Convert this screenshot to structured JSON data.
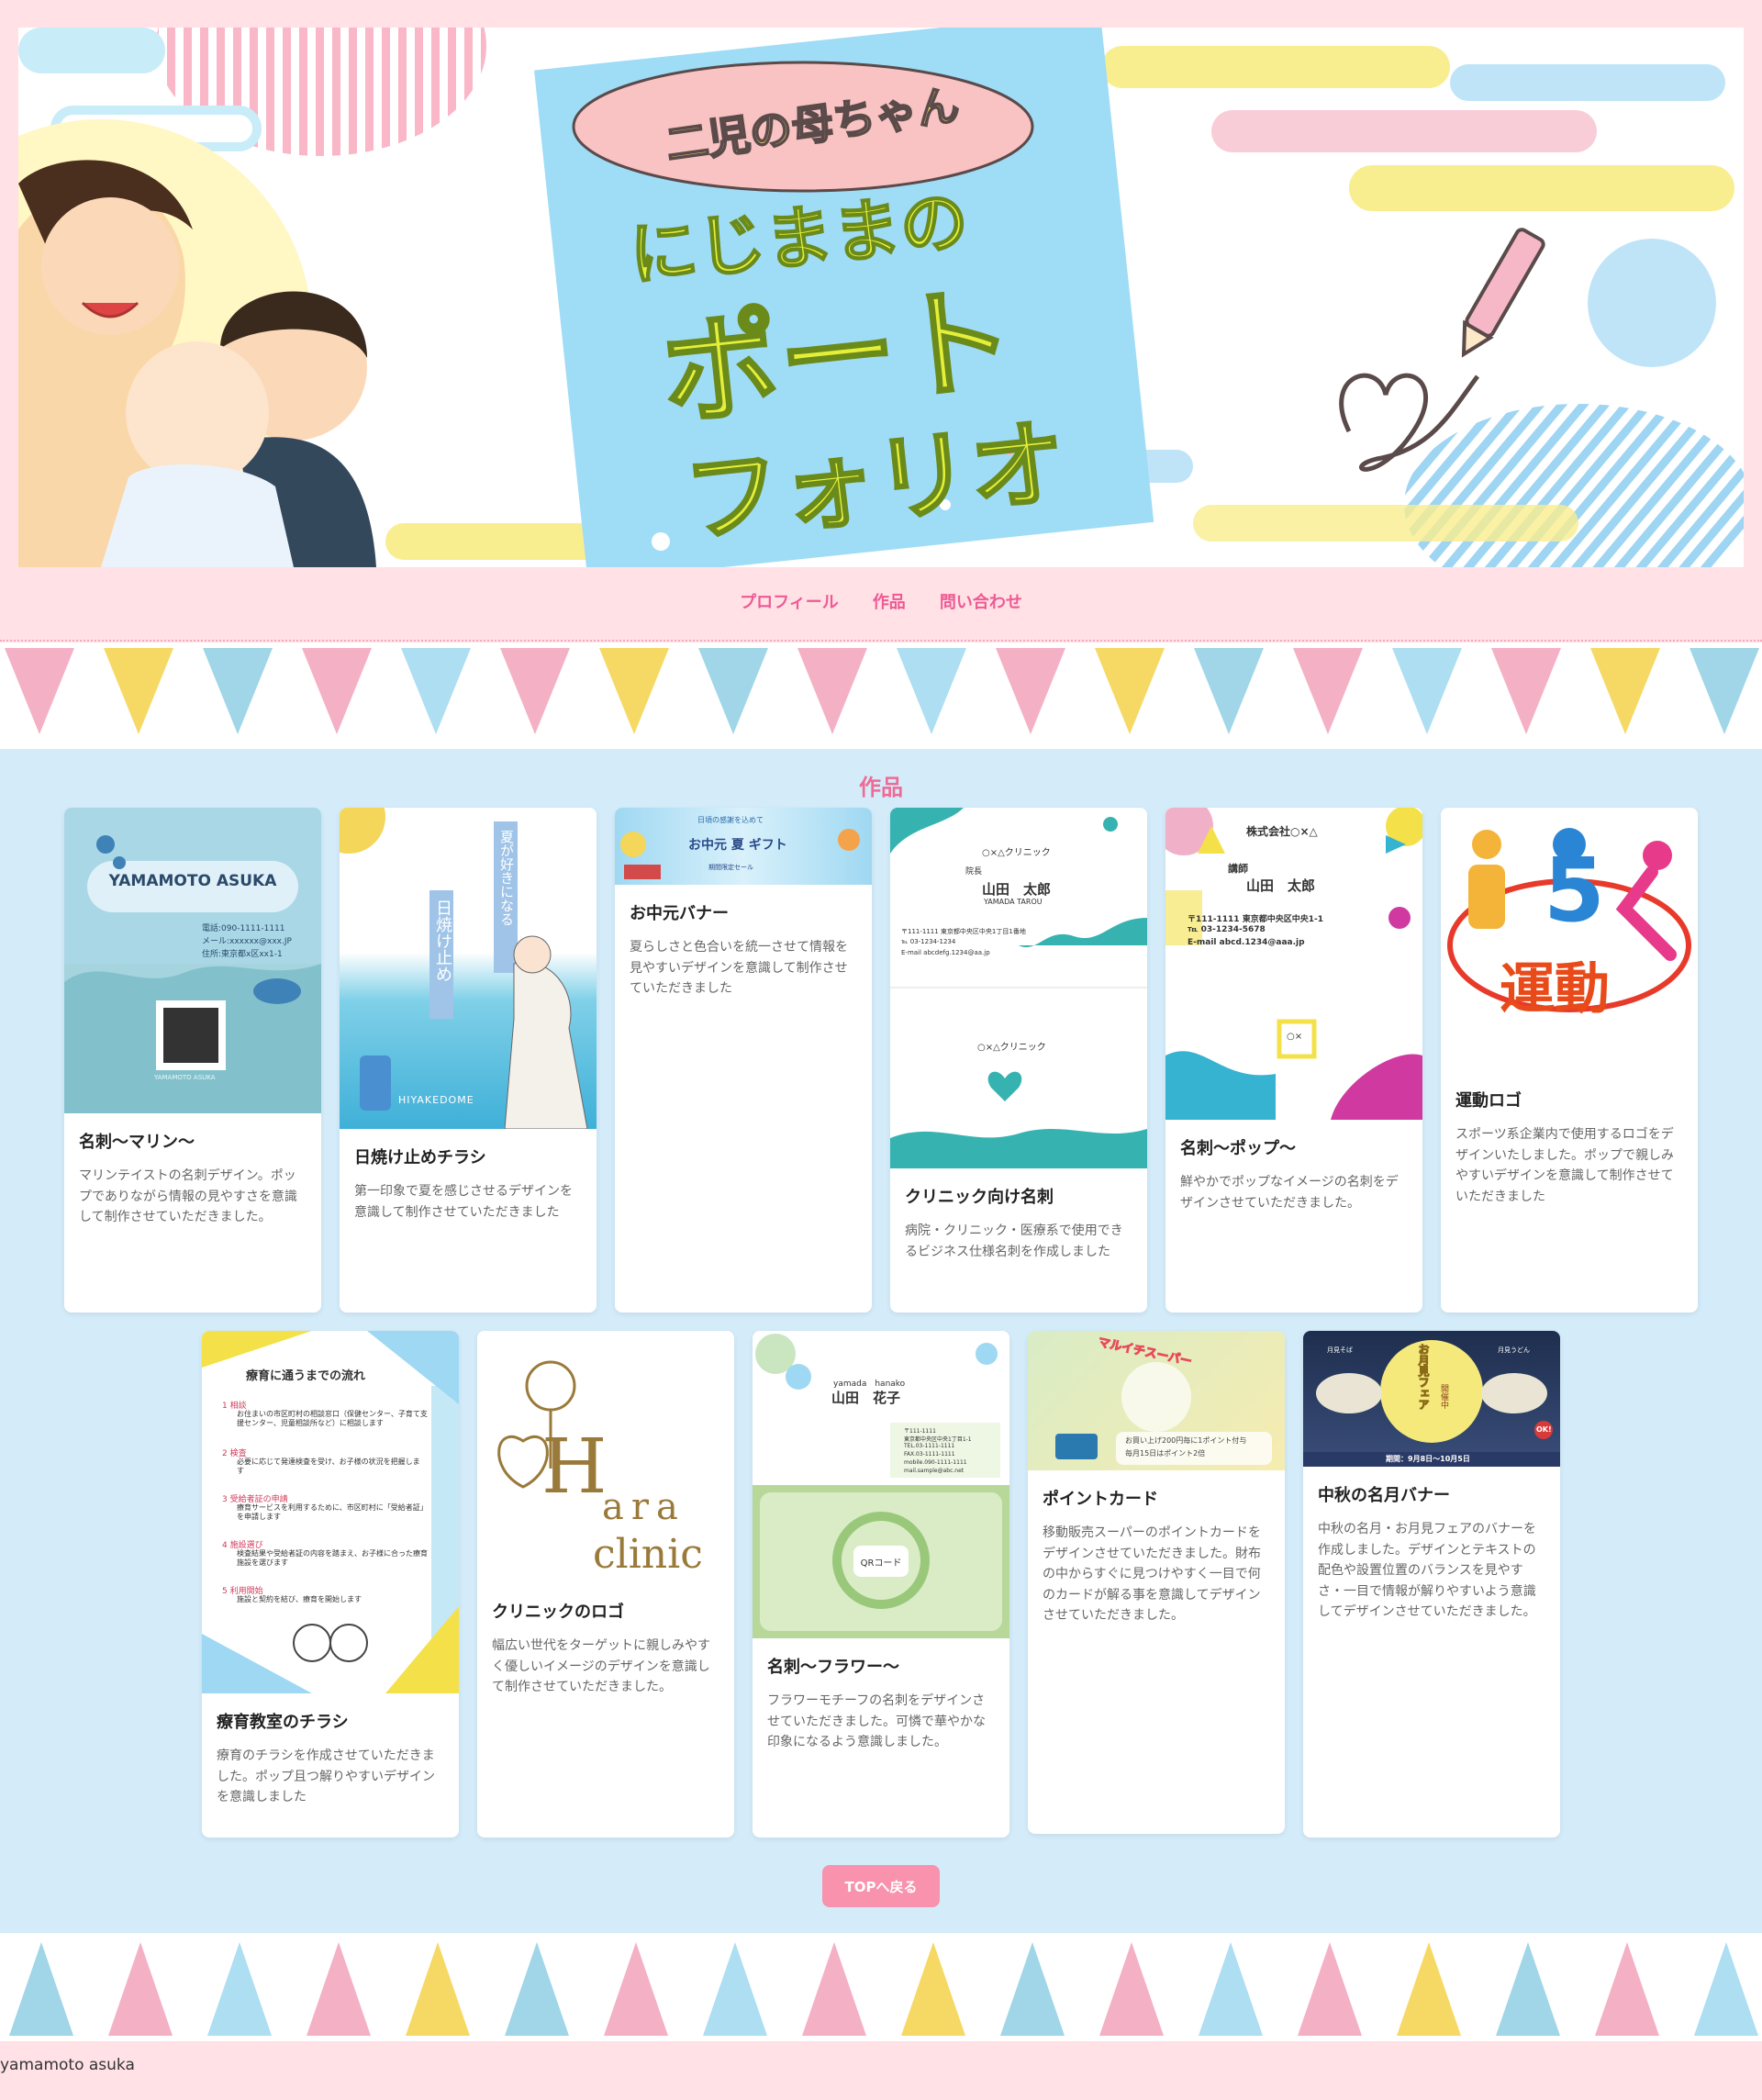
{
  "hero": {
    "subtitle": "二児の母ちゃん",
    "title_line1": "にじままの",
    "title_line2": "ポート",
    "title_line3": "フォリオ"
  },
  "nav": {
    "items": [
      "プロフィール",
      "作品",
      "問い合わせ"
    ]
  },
  "works": {
    "title": "作品",
    "cards": [
      {
        "title": "名刺〜マリン〜",
        "desc": "マリンテイストの名刺デザイン。ポップでありながら情報の見やすさを意識して制作させていただきました。",
        "thumb_text": [
          "YAMAMOTO ASUKA",
          "電話:090-1111-1111",
          "メール:xxxxxx@xxx.JP",
          "住所:東京都x区xx1-1",
          "YAMAMOTO ASUKA"
        ]
      },
      {
        "title": "日焼け止めチラシ",
        "desc": "第一印象で夏を感じさせるデザインを意識して制作させていただきました",
        "thumb_text": [
          "夏が好きになる",
          "日焼け止め",
          "HIYAKEDOME"
        ]
      },
      {
        "title": "お中元バナー",
        "desc": "夏らしさと色合いを統一させて情報を見やすいデザインを意識して制作させていただきました",
        "thumb_text": [
          "日頃の感謝を込めて",
          "お中元 夏 ギフト",
          "期間限定セール"
        ]
      },
      {
        "title": "クリニック向け名刺",
        "desc": "病院・クリニック・医療系で使用できるビジネス仕様名刺を作成しました",
        "thumb_text": [
          "○×△クリニック",
          "院長",
          "山田　太郎",
          "YAMADA TAROU",
          "〒111-1111 東京都中央区中央1丁目1番地",
          "℡ 03-1234-1234",
          "E-mail abcdefg.1234@aa.jp",
          "○×△クリニック"
        ]
      },
      {
        "title": "名刺〜ポップ〜",
        "desc": "鮮やかでポップなイメージの名刺をデザインさせていただきました。",
        "thumb_text": [
          "株式会社○×△",
          "講師",
          "山田　太郎",
          "〒111-1111 東京都中央区中央1-1",
          "℡ 03-1234-5678",
          "E-mail abcd.1234@aaa.jp",
          "○×"
        ]
      },
      {
        "title": "運動ロゴ",
        "desc": "スポーツ系企業内で使用するロゴをデザインいたしました。ポップで親しみやすいデザインを意識して制作させていただきました",
        "thumb_text": [
          "5",
          "運動"
        ]
      },
      {
        "title": "療育教室のチラシ",
        "desc": "療育のチラシを作成させていただきました。ポップ且つ解りやすいデザインを意識しました",
        "thumb_text": [
          "療育に通うまでの流れ",
          "1 相談",
          "お住まいの市区町村の相談窓口（保健センター、子育て支援センター、児童相談所など）に相談します",
          "2 検査",
          "必要に応じて発達検査を受け、お子様の状況を把握します",
          "3 受給者証の申請",
          "療育サービスを利用するために、市区町村に「受給者証」を申請します",
          "4 施設選び",
          "検査結果や受給者証の内容を踏まえ、お子様に合った療育施設を選びます",
          "5 利用開始",
          "施設と契約を結び、療育を開始します"
        ]
      },
      {
        "title": "クリニックのロゴ",
        "desc": "幅広い世代をターゲットに親しみやすく優しいイメージのデザインを意識して制作させていただきました。",
        "thumb_text": [
          "H",
          "ara",
          "clinic"
        ]
      },
      {
        "title": "名刺〜フラワー〜",
        "desc": "フラワーモチーフの名刺をデザインさせていただきました。可憐で華やかな印象になるよう意識しました。",
        "thumb_text": [
          "yamada　hanako",
          "山田　花子",
          "〒111-1111",
          "東京都中央区中央1丁目1-1",
          "TEL.03-1111-1111",
          "FAX.03-1111-1111",
          "mobile.090-1111-1111",
          "mail.sample@abc.net",
          "QRコード"
        ]
      },
      {
        "title": "ポイントカード",
        "desc": "移動販売スーパーのポイントカードをデザインさせていただきました。財布の中からすぐに見つけやすく一目で何のカードが解る事を意識してデザインさせていただきました。",
        "thumb_text": [
          "マルイチスーパー",
          "お買い上げ200円毎に1ポイント付与",
          "毎月15日はポイント2倍"
        ]
      },
      {
        "title": "中秋の名月バナー",
        "desc": "中秋の名月・お月見フェアのバナーを作成しました。デザインとテキストの配色や設置位置のバランスを見やすさ・一目で情報が解りやすいよう意識してデザインさせていただきました。",
        "thumb_text": [
          "月見そば",
          "お月見フェア",
          "開催中",
          "月見うどん",
          "OK!",
          "期間：9月8日〜10月5日"
        ]
      }
    ]
  },
  "top_button": "TOPへ戻る",
  "footer": {
    "text": "yamamoto asuka"
  },
  "colors": {
    "header_bg": "#ffe1e6",
    "main_bg": "#d4ecfa",
    "accent_pink": "#f06a95",
    "button_pink": "#f892ad"
  }
}
